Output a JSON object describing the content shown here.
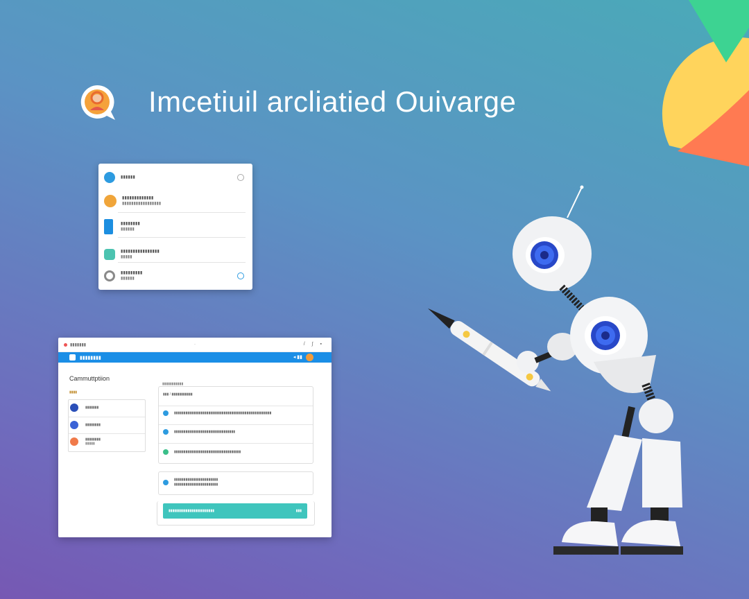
{
  "header": {
    "title": "Imcetiuil arcliatied Ouivarge"
  },
  "list_card": {
    "items": [
      {
        "line1": "▮▮▮▮▮▮",
        "line2": "",
        "icon": "info-dot-icon",
        "color": "#2d9be0"
      },
      {
        "line1": "▮▮▮▮▮▮▮▮▮▮▮▮▮",
        "line2": "▮▮▮▮▮▮▮▮▮▮▮▮▮▮▮▮▮",
        "icon": "location-pin-icon",
        "color": "#f0a53a"
      },
      {
        "line1": "▮▮▮▮▮▮▮▮",
        "line2": "▮▮▮▮▮▮",
        "icon": "document-icon",
        "color": "#1c8ee0"
      },
      {
        "line1": "▮▮▮▮▮▮▮▮▮▮▮▮▮▮▮▮",
        "line2": "▮▮▮▮▮",
        "icon": "chat-icon",
        "color": "#4cc3b0"
      },
      {
        "line1": "▮▮▮▮▮▮▮▮▮",
        "line2": "▮▮▮▮▮▮",
        "icon": "settings-icon",
        "color": "#8a8a8a"
      }
    ]
  },
  "window": {
    "chrome_text": "▮▮▮▮▮▮▮",
    "chrome_mid": "·",
    "chrome_right": "/ ∫ ▪",
    "app_name": "▮▮▮▮▮▮▮▮",
    "app_ctrl": "◂  ▮▮",
    "title": "Cammuttptiion",
    "left_section": "▮▮▮▮",
    "left_items": [
      {
        "t": "▮▮▮▮▮▮▮",
        "t2": "",
        "color": "#2a4fb8"
      },
      {
        "t": "▮▮▮▮▮▮▮▮",
        "t2": "",
        "color": "#3a62d6"
      },
      {
        "t": "▮▮▮▮▮▮▮▮",
        "t2": "▮▮▮▮▮",
        "color": "#f07a4a"
      }
    ],
    "panel_header": "▮▮▮▮▮▮▮▮▮▮▮",
    "panel_rows": [
      {
        "t": "▮▮▮ / ▮▮▮▮▮▮▮▮▮▮▮",
        "color": ""
      },
      {
        "t": "▮▮▮▮▮▮▮▮▮▮▮▮▮▮▮▮▮▮▮▮▮▮▮▮▮▮▮▮▮▮▮▮▮▮▮▮▮▮▮▮▮▮▮▮▮▮▮▮▮▮▮",
        "color": "#2d9be0"
      },
      {
        "t": "▮▮▮▮▮▮▮▮▮▮▮▮▮▮▮▮▮▮▮▮▮▮▮▮▮▮▮▮▮▮▮▮",
        "color": "#2d9be0"
      },
      {
        "t": "▮▮▮▮▮▮▮▮▮▮▮▮▮▮▮▮▮▮▮▮▮▮▮▮▮▮▮▮▮▮▮▮▮▮▮",
        "color": "#3bbf8a"
      }
    ],
    "info_row": {
      "t1": "▮▮▮▮▮▮▮▮▮▮▮▮▮▮▮▮▮▮▮▮▮▮▮",
      "t2": "▮▮▮▮▮▮▮▮▮▮▮▮▮▮▮▮▮▮▮▮▮▮▮",
      "color": "#2d9be0"
    },
    "cta_label": "▮▮▮▮▮▮▮▮▮▮▮▮▮▮▮▮▮▮▮▮▮▮▮▮",
    "cta_arrow": "▮▮▮"
  },
  "colors": {
    "accent_blue": "#1b8ee6",
    "accent_teal": "#3fc5bd"
  }
}
